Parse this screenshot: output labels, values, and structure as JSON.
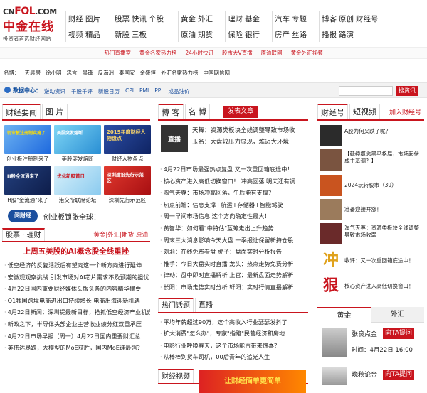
{
  "logo": {
    "brand1": "CN",
    "brand2": "FOL",
    "brand3": ".COM",
    "cn_name": "中金在线",
    "slogan": "投资者首选财经网站"
  },
  "nav": [
    {
      "row1": [
        "财经",
        "图片"
      ],
      "row2": [
        "视频",
        "精品"
      ]
    },
    {
      "row1": [
        "股票",
        "快讯",
        "个股"
      ],
      "row2": [
        "新股",
        "三板"
      ]
    },
    {
      "row1": [
        "黄金",
        "外汇"
      ],
      "row2": [
        "原油",
        "期货"
      ]
    },
    {
      "row1": [
        "理财",
        "基金"
      ],
      "row2": [
        "保险",
        "银行"
      ]
    },
    {
      "row1": [
        "汽车",
        "专题"
      ],
      "row2": [
        "房产",
        "丝路"
      ]
    },
    {
      "row1": [
        "博客",
        "原创",
        "财经号"
      ],
      "row2": [
        "播报",
        "路演"
      ]
    }
  ],
  "hotbar": [
    "热门直播室",
    "黄金名家热力榜",
    "24小时快讯",
    "股市大V直播",
    "原油联网",
    "黄金外汇视频"
  ],
  "names": {
    "label": "名博：",
    "items": [
      "天晨居",
      "徐小明",
      "忠言",
      "晨锋",
      "反海洲",
      "秦国安",
      "余盛恒",
      "外汇名家热力榜",
      "中国网信网"
    ]
  },
  "datacenter": {
    "label": "数据中心：",
    "items": [
      "逆动资讯",
      "千股千评",
      "新股日历",
      "CPI",
      "PMI",
      "PPI",
      "成品油价"
    ],
    "search_button": "搜资讯",
    "search_placeholder": ""
  },
  "left": {
    "tabs": [
      "财经要闻",
      "图 片"
    ],
    "thumbs": [
      {
        "cap": "创业板注册制来了",
        "color": "#3b7ec8"
      },
      {
        "cap": "美股突发熔断",
        "color": "#2f9fd4"
      },
      {
        "cap": "财经人物盘点",
        "color": "#1f3f8f"
      },
      {
        "cap": "H股\"金流通\"来了",
        "color": "#1a2f6e"
      },
      {
        "cap": "港交所联席论坛",
        "color": "#2a86c9"
      },
      {
        "cap": "深圳先行示范区",
        "color": "#c8231b"
      }
    ],
    "thumb_titles": [
      "创业板注册制实施了",
      "美股突发熔断",
      "2019年度财经人物盘点",
      "H股全流通来了",
      "优化新股首日",
      "深圳建设先行示范区"
    ],
    "banner": {
      "logo": "阅财经",
      "text": "创业板锁张全球！"
    },
    "stock_tabs": [
      "股票 · 理财"
    ],
    "stock_links": [
      "黄金",
      "外汇",
      "期货",
      "原油"
    ],
    "headline": "上周五美股的AI概念股全线重挫",
    "news": [
      "低空经济的反复活跃后有望向这一个新方向进行延伸",
      "宏微观观察挑战 引发市场对AI芯片需求不及预期的担忧",
      "4月22日国内重要财经媒体头版头条的内容精华摘要",
      "Q1我国跨境电商进出口持续增长 电商出海迎新机遇",
      "4月22日新闻：深圳提最新目标，抢抓低空经济产业机遇",
      "新政之下，半导体头部企业主营收业绩分红双重承压",
      "4月22日市场早报（周一）4月22日国内重要财汇总",
      "英伟达暴跌，大模型的MoE获胜，国内MoE谁最强？"
    ]
  },
  "middle": {
    "tabs": [
      "博 客",
      "名 博"
    ],
    "post_button": "发表文章",
    "blogs": [
      {
        "title": "天舞：资源类板块全线调整导致市场收"
      },
      {
        "title": "玉名：大盘较压力显现，难迈大环境"
      }
    ],
    "blog_tag": "直播",
    "news": [
      "4月22日市场最强热点复盘 又一次重回箱底途中！",
      "核心资产进入高低切换窗口！ 冲高回落 明天还有调",
      "淘气天尊：市场冲高回落，午后能有支撑？",
      "热点前瞻：信息支撑+航运+存储器+智能驾驶",
      "周一早间市场信息 这个方向确定性最大！",
      "黄智华：如何看\"中特估\"蓝筹走出上升趋势",
      "周末三大消息影响今天大盘 一季报让保留新持仓股",
      "刘莉：在线免费看盘 虎子：盘面实时分析报告",
      "推手：今日大盘实时直播 龙头：热点走势免费分析",
      "律动：盘中即时直播解析 上官：最新盘面走势解析",
      "长阳：市场走势实时分析 轩阳：实时行情直播解析"
    ],
    "hot_tabs": [
      "热门话题",
      "直播"
    ],
    "hot_news": [
      "平均年薪超过90万，这个高收入行业瑟瑟发抖了",
      "扩大消费\"怎么办\"，专家\"指路\"民营经济和房地",
      "电影行业呼唤春天，这个市场能否带来惊喜？",
      "从棒棒到货车司机，00后青年的追光人生"
    ],
    "video_tab": "财经视频",
    "video_banner": "让财经简单更简单"
  },
  "right": {
    "tabs": [
      "财经号",
      "短视频",
      "加入财经号"
    ],
    "items": [
      {
        "text": "A股为何又跌了呢？",
        "color": "#2b2b2b"
      },
      {
        "text": "【延续概念黑马格局，市场起伏成主基调？】",
        "color": "#5a3a2a"
      },
      {
        "text": "2024玩转股市（39）",
        "color": "#c9541f"
      },
      {
        "text": "准备迎接开涨！",
        "color": "#8a6a4a"
      },
      {
        "text": "淘气天尊：资源类板块全线调整导致市场收弱",
        "color": "#6a2a2a"
      },
      {
        "text": "收评：又一次重回箱底途中！",
        "color": "#d8b56b"
      },
      {
        "text": "核心资产进入高低切换窗口！",
        "color": "#eeeeee"
      }
    ],
    "item_tags": [
      "冲",
      "狠"
    ],
    "fx_tabs": [
      "黄金",
      "外汇"
    ],
    "analysts": [
      {
        "name": "张良点金",
        "tag": "向TA提问",
        "time": "时间：4月22日 16:00"
      },
      {
        "name": "晚秋论金",
        "tag": "向TA提问",
        "time": ""
      }
    ]
  },
  "colors": {
    "brand_red": "#c9151e",
    "link_blue": "#1b4f9e"
  }
}
